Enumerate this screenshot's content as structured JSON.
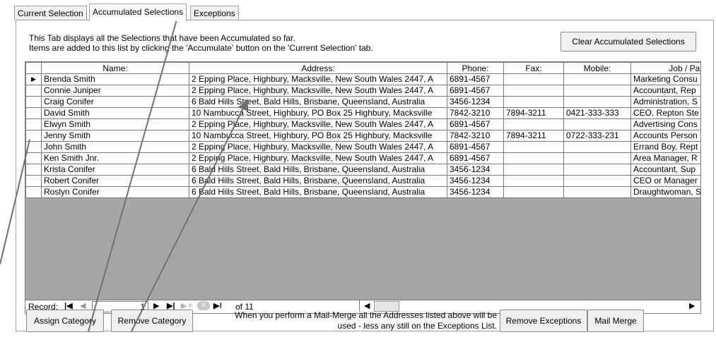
{
  "tabs": [
    {
      "label": "Current Selection"
    },
    {
      "label": "Accumulated Selections"
    },
    {
      "label": "Exceptions"
    }
  ],
  "info": {
    "line1": "This Tab displays all the Selections that have been Accumulated so far.",
    "line2": "Items are added to this list by clicking the 'Accumulate' button on the 'Current Selection' tab."
  },
  "buttons": {
    "clear_accumulated": "Clear Accumulated Selections",
    "assign_category": "Assign Category",
    "remove_category": "Remove Category",
    "remove_exceptions": "Remove Exceptions",
    "mail_merge": "Mail Merge"
  },
  "columns": [
    "Name:",
    "Address:",
    "Phone:",
    "Fax:",
    "Mobile:",
    "Job / Pare"
  ],
  "rows": [
    {
      "name": "Brenda Smith",
      "address": "2 Epping Place, Highbury, Macksville, New South Wales 2447, A",
      "phone": "6891-4567",
      "fax": "",
      "mobile": "",
      "job": "Marketing Consu"
    },
    {
      "name": "Connie Juniper",
      "address": "2 Epping Place, Highbury, Macksville, New South Wales 2447, A",
      "phone": "6891-4567",
      "fax": "",
      "mobile": "",
      "job": "Accountant, Rep"
    },
    {
      "name": "Craig Conifer",
      "address": "6 Bald Hills Street, Bald Hills, Brisbane, Queensland, Australia",
      "phone": "3456-1234",
      "fax": "",
      "mobile": "",
      "job": "Administration, S"
    },
    {
      "name": "David Smith",
      "address": "10 Nambucca Street, Highbury, PO Box 25 Highbury, Macksville",
      "phone": "7842-3210",
      "fax": "7894-3211",
      "mobile": "0421-333-333",
      "job": "CEO, Repton Ste"
    },
    {
      "name": "Elwyn Smith",
      "address": "2 Epping Place, Highbury, Macksville, New South Wales 2447, A",
      "phone": "6891-4567",
      "fax": "",
      "mobile": "",
      "job": "Advertising Cons"
    },
    {
      "name": "Jenny Smith",
      "address": "10 Nambucca Street, Highbury, PO Box 25 Highbury, Macksville",
      "phone": "7842-3210",
      "fax": "7894-3211",
      "mobile": "0722-333-231",
      "job": "Accounts Person"
    },
    {
      "name": "John Smith",
      "address": "2 Epping Place, Highbury, Macksville, New South Wales 2447, A",
      "phone": "6891-4567",
      "fax": "",
      "mobile": "",
      "job": "Errand Boy, Rept"
    },
    {
      "name": "Ken Smith Jnr.",
      "address": "2 Epping Place, Highbury, Macksville, New South Wales 2447, A",
      "phone": "6891-4567",
      "fax": "",
      "mobile": "",
      "job": "Area Manager, R"
    },
    {
      "name": "Krista Conifer",
      "address": "6 Bald Hills Street, Bald Hills, Brisbane, Queensland, Australia",
      "phone": "3456-1234",
      "fax": "",
      "mobile": "",
      "job": "Accountant, Sup"
    },
    {
      "name": "Robert Conifer",
      "address": "6 Bald Hills Street, Bald Hills, Brisbane, Queensland, Australia",
      "phone": "3456-1234",
      "fax": "",
      "mobile": "",
      "job": "CEO or Manager"
    },
    {
      "name": "Roslyn Conifer",
      "address": "6 Bald Hills Street, Bald Hills, Brisbane, Queensland, Australia",
      "phone": "3456-1234",
      "fax": "",
      "mobile": "",
      "job": "Draughtwoman, S"
    }
  ],
  "record_nav": {
    "label": "Record:",
    "current": "1",
    "of_text": "of 11"
  },
  "mailmerge_note": {
    "line1": "When you perform a Mail-Merge all the Addresses listed above will be",
    "line2": "used - less any still on the Exceptions List."
  },
  "colors": {
    "tab_bg": "#f0f0f0",
    "grid_empty": "#a6a6a6",
    "border": "#7a7a7a",
    "annotation_line": "#707070"
  }
}
